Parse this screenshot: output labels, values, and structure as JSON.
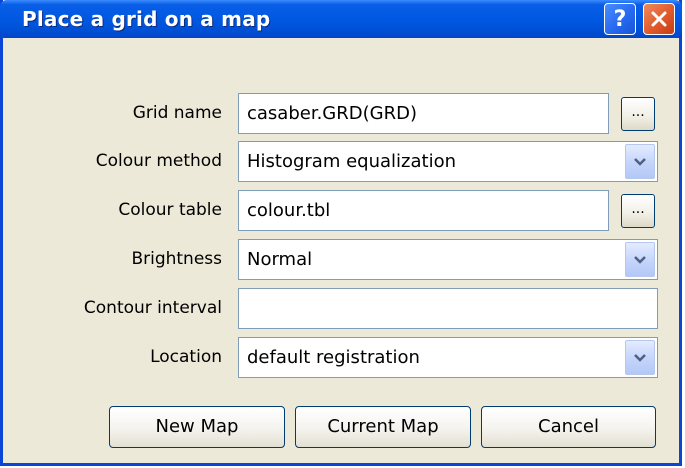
{
  "window": {
    "title": "Place a grid on a map",
    "help_label": "?",
    "icons": {
      "help": "help-icon",
      "close": "close-icon",
      "dropdown": "chevron-down-icon"
    }
  },
  "form": {
    "grid_name": {
      "label": "Grid name",
      "value": "casaber.GRD(GRD)",
      "browse_label": "..."
    },
    "colour_method": {
      "label": "Colour method",
      "value": "Histogram equalization"
    },
    "colour_table": {
      "label": "Colour table",
      "value": "colour.tbl",
      "browse_label": "..."
    },
    "brightness": {
      "label": "Brightness",
      "value": "Normal"
    },
    "contour_interval": {
      "label": "Contour interval",
      "value": ""
    },
    "location": {
      "label": "Location",
      "value": "default registration"
    }
  },
  "buttons": {
    "new_map": "New Map",
    "current_map": "Current Map",
    "cancel": "Cancel"
  },
  "colors": {
    "titlebar": "#0058e2",
    "dialog_bg": "#ece9d8",
    "close_button": "#e05a2c",
    "field_border": "#7f9db9"
  }
}
